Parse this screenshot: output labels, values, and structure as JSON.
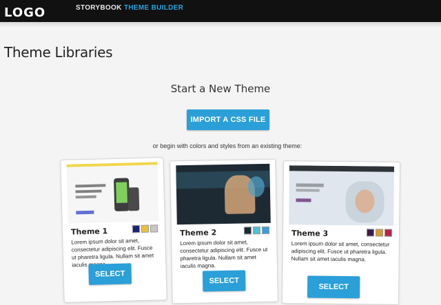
{
  "header": {
    "logo": "LOGO",
    "nav": [
      {
        "label": "STORYBOOK",
        "active": false
      },
      {
        "label": "THEME BUILDER",
        "active": true
      }
    ],
    "accent": "#27a3e0"
  },
  "main": {
    "page_title": "Theme Libraries",
    "start_title": "Start a New Theme",
    "import_button": "IMPORT A CSS FILE",
    "begin_text": "or begin with colors and styles from an existing theme:"
  },
  "themes": [
    {
      "name": "Theme 1",
      "swatches": [
        "#1d1f7a",
        "#e9c23a",
        "#c7c7c7"
      ],
      "description": "Lorem ipsum dolor sit amet, consectetur adipiscing elit. Fusce ut pharetra ligula. Nullam sit amet iaculis magna.",
      "button": "SELECT"
    },
    {
      "name": "Theme 2",
      "swatches": [
        "#1b2a35",
        "#4fc0d2",
        "#3a9fd8"
      ],
      "description": "Lorem ipsum dolor sit amet, consectetur adipiscing elit. Fusce ut pharetra ligula. Nullam sit amet iaculis magna.",
      "button": "SELECT"
    },
    {
      "name": "Theme 3",
      "swatches": [
        "#3b1a4f",
        "#d99a33",
        "#b5234a"
      ],
      "description": "Lorem ipsum dolor sit amet, consectetur adipiscing elit. Fusce ut pharetra ligula. Nullam sit amet iaculis magna.",
      "button": "SELECT"
    }
  ]
}
